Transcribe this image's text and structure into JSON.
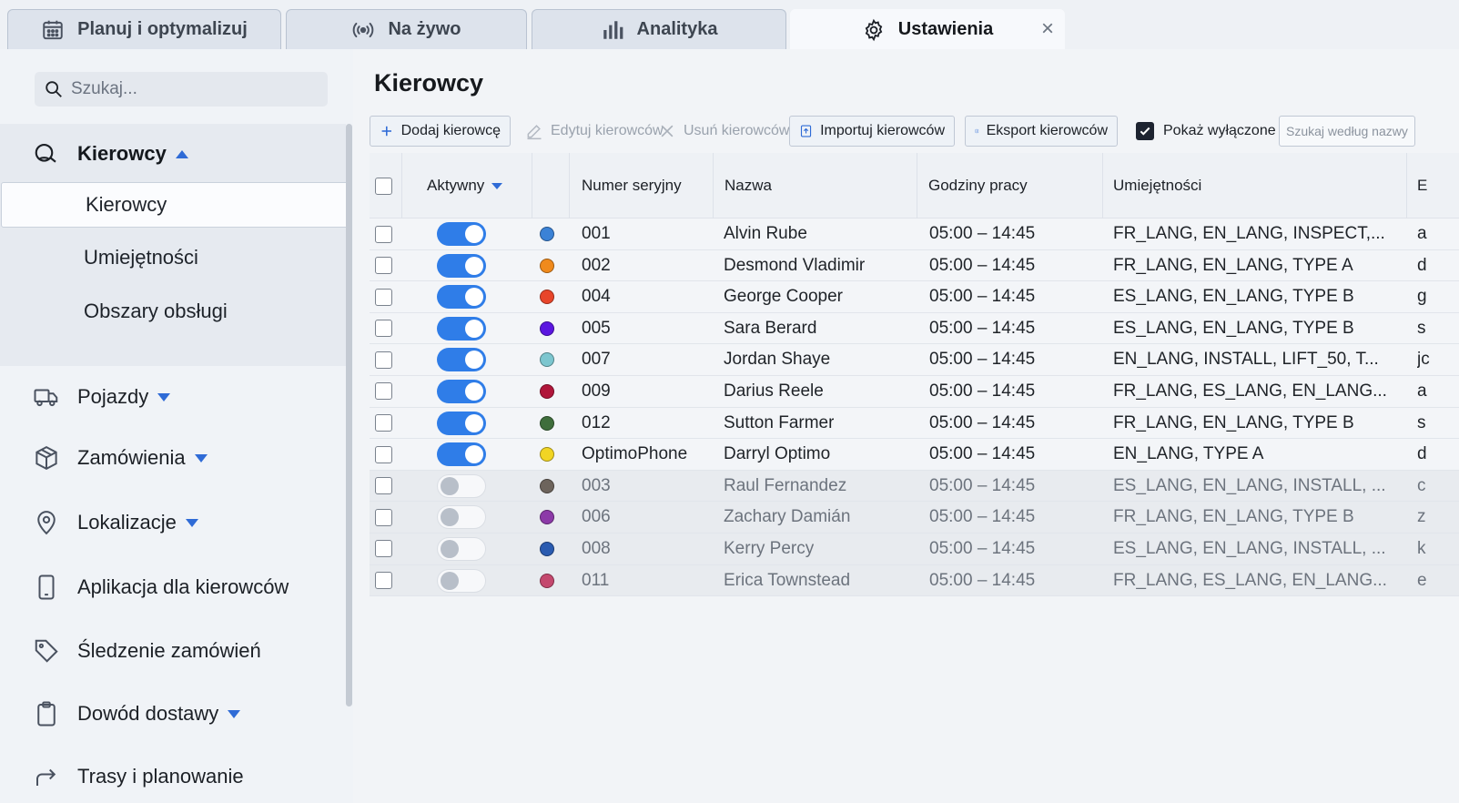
{
  "tabs": [
    {
      "label": "Planuj i optymalizuj",
      "icon": "calendar-icon"
    },
    {
      "label": "Na żywo",
      "icon": "broadcast-icon"
    },
    {
      "label": "Analityka",
      "icon": "bar-chart-icon"
    },
    {
      "label": "Ustawienia",
      "icon": "gear-icon",
      "active": true
    }
  ],
  "sidebar": {
    "search_placeholder": "Szukaj...",
    "drivers_group": "Kierowcy",
    "sub_items": [
      "Kierowcy",
      "Umiejętności",
      "Obszary obsługi"
    ],
    "items": [
      {
        "label": "Pojazdy",
        "icon": "truck-icon",
        "has_caret": true
      },
      {
        "label": "Zamówienia",
        "icon": "package-icon",
        "has_caret": true
      },
      {
        "label": "Lokalizacje",
        "icon": "map-pin-icon",
        "has_caret": true
      },
      {
        "label": "Aplikacja dla kierowców",
        "icon": "phone-icon",
        "has_caret": false
      },
      {
        "label": "Śledzenie zamówień",
        "icon": "tag-icon",
        "has_caret": false
      },
      {
        "label": "Dowód dostawy",
        "icon": "clipboard-icon",
        "has_caret": true
      },
      {
        "label": "Trasy i planowanie",
        "icon": "route-icon",
        "has_caret": false
      }
    ]
  },
  "main": {
    "title": "Kierowcy",
    "toolbar": {
      "add": "Dodaj kierowcę",
      "edit": "Edytuj kierowców",
      "delete": "Usuń kierowców",
      "import": "Importuj kierowców",
      "export": "Eksport kierowców",
      "show_disabled": "Pokaż wyłączone",
      "name_search_placeholder": "Szukaj według nazwy"
    },
    "columns": {
      "active": "Aktywny",
      "serial": "Numer seryjny",
      "name": "Nazwa",
      "hours": "Godziny pracy",
      "skills": "Umiejętności",
      "extra": "E"
    },
    "rows": [
      {
        "active": true,
        "color": "#3b82d6",
        "serial": "001",
        "name": "Alvin Rube",
        "hours": "05:00 – 14:45",
        "skills": "FR_LANG, EN_LANG, INSPECT,...",
        "extra": "a"
      },
      {
        "active": true,
        "color": "#f08a1c",
        "serial": "002",
        "name": "Desmond Vladimir",
        "hours": "05:00 – 14:45",
        "skills": "FR_LANG, EN_LANG, TYPE A",
        "extra": "d"
      },
      {
        "active": true,
        "color": "#e8452a",
        "serial": "004",
        "name": "George Cooper",
        "hours": "05:00 – 14:45",
        "skills": "ES_LANG, EN_LANG, TYPE B",
        "extra": "g"
      },
      {
        "active": true,
        "color": "#5b16e0",
        "serial": "005",
        "name": "Sara Berard",
        "hours": "05:00 – 14:45",
        "skills": "ES_LANG, EN_LANG, TYPE B",
        "extra": "s"
      },
      {
        "active": true,
        "color": "#7cc6cf",
        "serial": "007",
        "name": "Jordan Shaye",
        "hours": "05:00 – 14:45",
        "skills": "EN_LANG, INSTALL, LIFT_50, T...",
        "extra": "jc"
      },
      {
        "active": true,
        "color": "#b0163a",
        "serial": "009",
        "name": "Darius Reele",
        "hours": "05:00 – 14:45",
        "skills": "FR_LANG, ES_LANG, EN_LANG...",
        "extra": "a"
      },
      {
        "active": true,
        "color": "#3f6e3c",
        "serial": "012",
        "name": "Sutton Farmer",
        "hours": "05:00 – 14:45",
        "skills": "FR_LANG, EN_LANG, TYPE B",
        "extra": "s"
      },
      {
        "active": true,
        "color": "#f1d524",
        "serial": "OptimoPhone",
        "name": "Darryl Optimo",
        "hours": "05:00 – 14:45",
        "skills": "EN_LANG, TYPE A",
        "extra": "d"
      },
      {
        "active": false,
        "color": "#6d645c",
        "serial": "003",
        "name": "Raul Fernandez",
        "hours": "05:00 – 14:45",
        "skills": "ES_LANG, EN_LANG, INSTALL, ...",
        "extra": "c"
      },
      {
        "active": false,
        "color": "#8c3aa8",
        "serial": "006",
        "name": "Zachary Damián",
        "hours": "05:00 – 14:45",
        "skills": "FR_LANG, EN_LANG, TYPE B",
        "extra": "z"
      },
      {
        "active": false,
        "color": "#2a5bb0",
        "serial": "008",
        "name": "Kerry Percy",
        "hours": "05:00 – 14:45",
        "skills": "ES_LANG, EN_LANG, INSTALL, ...",
        "extra": "k"
      },
      {
        "active": false,
        "color": "#c4486e",
        "serial": "011",
        "name": "Erica Townstead",
        "hours": "05:00 – 14:45",
        "skills": "FR_LANG, ES_LANG, EN_LANG...",
        "extra": "e"
      }
    ]
  },
  "colors": {
    "accent": "#2f7de8",
    "toggle_off": "#f7f8fa"
  }
}
